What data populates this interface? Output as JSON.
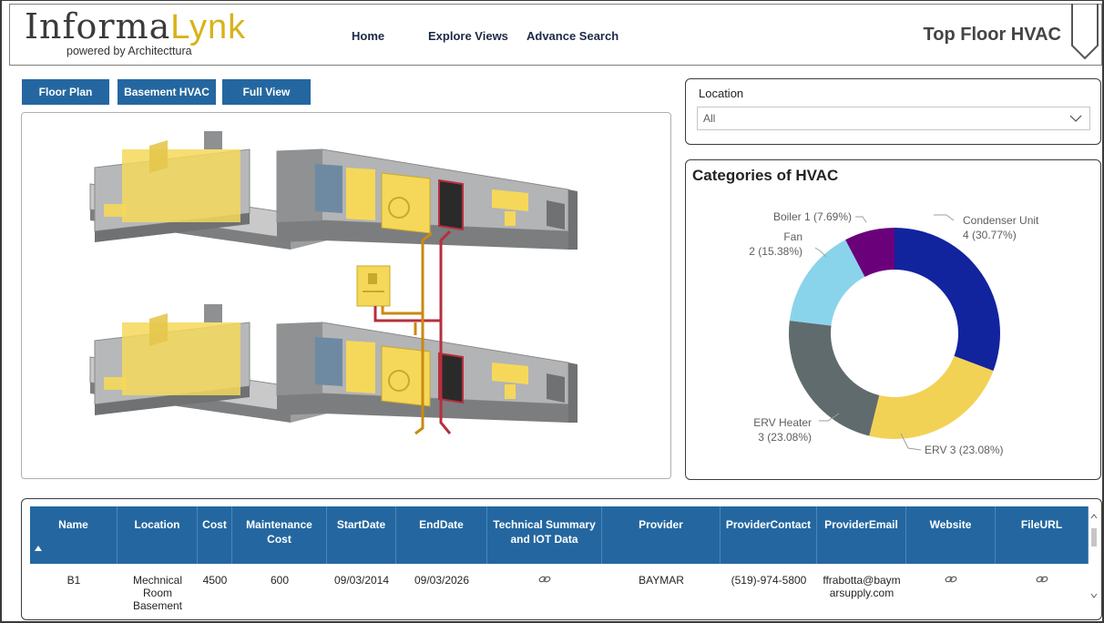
{
  "header": {
    "logo_main_a": "Informa",
    "logo_main_b": "Lynk",
    "logo_sub": "powered by Architecttura",
    "nav": [
      "Home",
      "Explore Views",
      "Advance Search"
    ],
    "page_title": "Top Floor HVAC"
  },
  "view_buttons": [
    "Floor Plan",
    "Basement HVAC",
    "Full View"
  ],
  "location_slicer": {
    "label": "Location",
    "value": "All",
    "icon": "chevron-down-icon"
  },
  "colors": {
    "accent_blue": "#2467a0",
    "condenser": "#12239e",
    "erv": "#f2d255",
    "erv_heater": "#5f6b6d",
    "fan": "#8ad4eb",
    "boiler": "#6b007b",
    "equipment_yellow": "#f5d85a",
    "pipe_red": "#b72f3d",
    "pipe_orange": "#c98a10"
  },
  "chart_data": {
    "type": "pie",
    "title": "Categories of HVAC",
    "donut": true,
    "slices": [
      {
        "name": "Condenser Unit",
        "value": 4,
        "percent": "30.77%",
        "label_a": "Condenser Unit",
        "label_b": "4 (30.77%)"
      },
      {
        "name": "ERV",
        "value": 3,
        "percent": "23.08%",
        "label_a": "ERV 3 (23.08%)",
        "label_b": ""
      },
      {
        "name": "ERV Heater",
        "value": 3,
        "percent": "23.08%",
        "label_a": "ERV Heater",
        "label_b": "3 (23.08%)"
      },
      {
        "name": "Fan",
        "value": 2,
        "percent": "15.38%",
        "label_a": "Fan",
        "label_b": "2 (15.38%)"
      },
      {
        "name": "Boiler",
        "value": 1,
        "percent": "7.69%",
        "label_a": "Boiler 1 (7.69%)",
        "label_b": ""
      }
    ]
  },
  "table": {
    "columns": [
      [
        "Name"
      ],
      [
        "Location"
      ],
      [
        "Cost"
      ],
      [
        "Maintenance",
        "Cost"
      ],
      [
        "StartDate"
      ],
      [
        "EndDate"
      ],
      [
        "Technical Summary",
        "and IOT Data"
      ],
      [
        "Provider"
      ],
      [
        "ProviderContact"
      ],
      [
        "ProviderEmail"
      ],
      [
        "Website"
      ],
      [
        "FileURL"
      ]
    ],
    "sort_icon": "sort-ascending-icon",
    "rows": [
      {
        "name": "B1",
        "location": [
          "Mechnical",
          "Room",
          "Basement"
        ],
        "cost": "4500",
        "maintenance_cost": "600",
        "start_date": "09/03/2014",
        "end_date": "09/03/2026",
        "technical_summary": "link-icon",
        "provider": "BAYMAR",
        "provider_contact": "(519)-974-5800",
        "provider_email": [
          "ffrabotta@baym",
          "arsupply.com"
        ],
        "website": "link-icon",
        "file_url": "link-icon"
      }
    ]
  }
}
